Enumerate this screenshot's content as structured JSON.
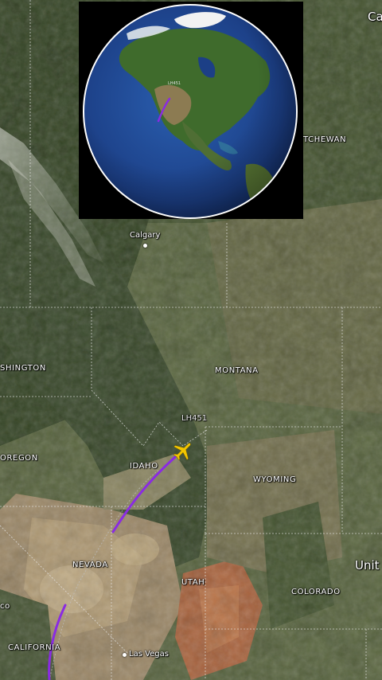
{
  "map": {
    "labels": {
      "calgary": "Calgary",
      "canada_partial": "Ca",
      "saskatchewan_partial": "TCHEWAN",
      "washington_partial": "SHINGTON",
      "montana": "MONTANA",
      "idaho": "IDAHO",
      "oregon_partial": "OREGON",
      "wyoming": "WYOMING",
      "nevada": "NEVADA",
      "utah": "UTAH",
      "colorado": "COLORADO",
      "united_partial": "Unit",
      "california": "CALIFORNIA",
      "las_vegas": "Las Vegas",
      "cali_partial": "co"
    },
    "flight_id": "LH451",
    "route_color": "#8a2be2",
    "plane_color": "#f2c500",
    "plane_icon": "airplane-icon"
  },
  "inset": {
    "flight_id": "LH451",
    "description_icon": "globe-icon"
  }
}
